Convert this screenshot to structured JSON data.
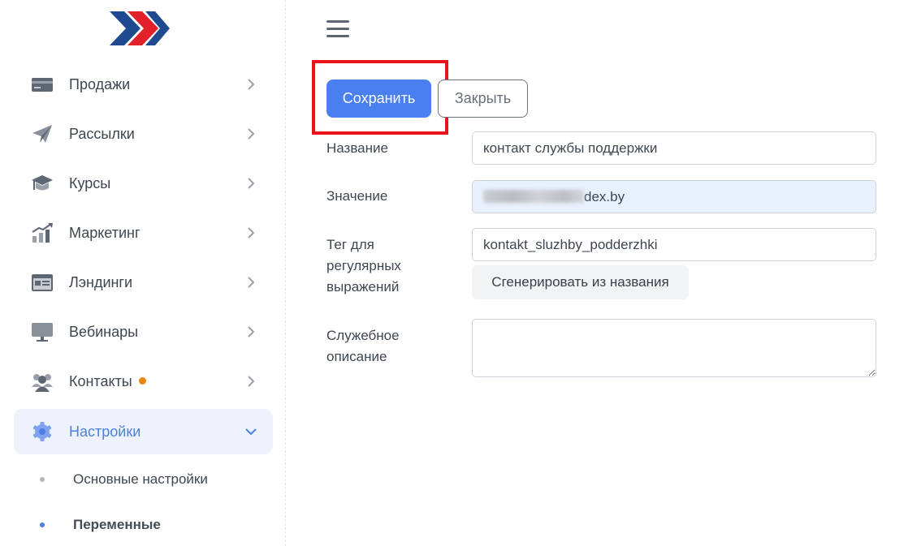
{
  "sidebar": {
    "items": [
      {
        "label": "Продажи",
        "icon": "credit-card-icon"
      },
      {
        "label": "Рассылки",
        "icon": "paper-plane-icon"
      },
      {
        "label": "Курсы",
        "icon": "graduation-cap-icon"
      },
      {
        "label": "Маркетинг",
        "icon": "chart-growth-icon"
      },
      {
        "label": "Лэндинги",
        "icon": "landing-page-icon"
      },
      {
        "label": "Вебинары",
        "icon": "monitor-icon"
      },
      {
        "label": "Контакты",
        "icon": "users-icon"
      },
      {
        "label": "Настройки",
        "icon": "gear-icon"
      }
    ],
    "sub_items": [
      {
        "label": "Основные настройки"
      },
      {
        "label": "Переменные"
      }
    ]
  },
  "toolbar": {
    "save_label": "Сохранить",
    "close_label": "Закрыть"
  },
  "form": {
    "name_label": "Название",
    "name_value": "контакт службы поддержки",
    "value_label": "Значение",
    "value_visible_suffix": "dex.by",
    "tag_label": "Тег для регулярных выражений",
    "tag_value": "kontakt_sluzhby_podderzhki",
    "generate_label": "Сгенерировать из названия",
    "description_label": "Служебное описание",
    "description_value": ""
  },
  "colors": {
    "accent": "#4a7ff0",
    "active_nav_bg": "#edf2fd",
    "highlight": "#e6141a",
    "badge": "#e8870c"
  }
}
